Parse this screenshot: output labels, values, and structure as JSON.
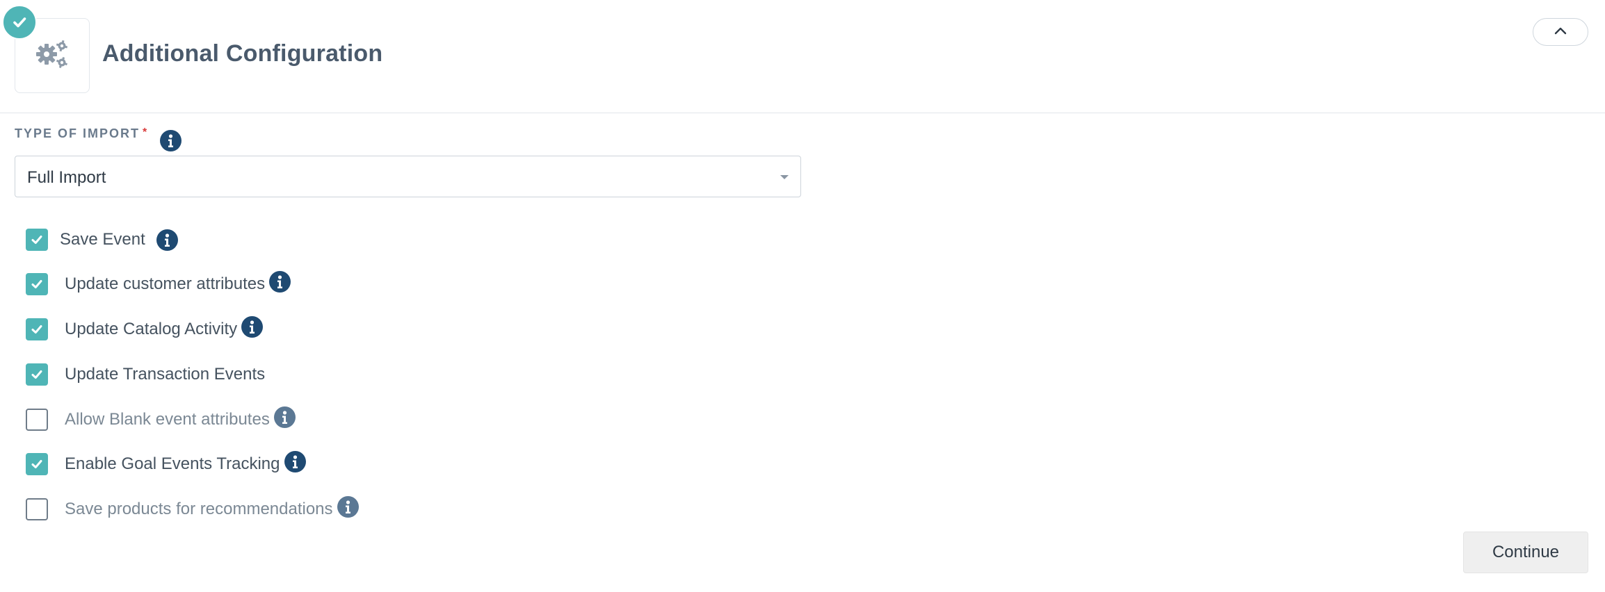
{
  "section": {
    "title": "Additional Configuration",
    "status_icon": "check-circle-icon",
    "section_icon": "gears-icon",
    "collapse_icon": "chevron-up-icon"
  },
  "import_type": {
    "label": "TYPE OF IMPORT",
    "required_marker": "*",
    "selected": "Full Import"
  },
  "options": [
    {
      "label": "Save Event",
      "checked": true,
      "has_info": true
    },
    {
      "label": "Update customer attributes",
      "checked": true,
      "has_info": true
    },
    {
      "label": "Update Catalog Activity",
      "checked": true,
      "has_info": true
    },
    {
      "label": "Update Transaction Events",
      "checked": true,
      "has_info": false
    },
    {
      "label": "Allow Blank event attributes",
      "checked": false,
      "has_info": true
    },
    {
      "label": "Enable Goal Events Tracking",
      "checked": true,
      "has_info": true
    },
    {
      "label": "Save products for recommendations",
      "checked": false,
      "has_info": true
    }
  ],
  "actions": {
    "continue_label": "Continue"
  },
  "colors": {
    "accent": "#4fb5b6",
    "info_icon": "#1f4a72",
    "title_text": "#4a5a6c"
  }
}
